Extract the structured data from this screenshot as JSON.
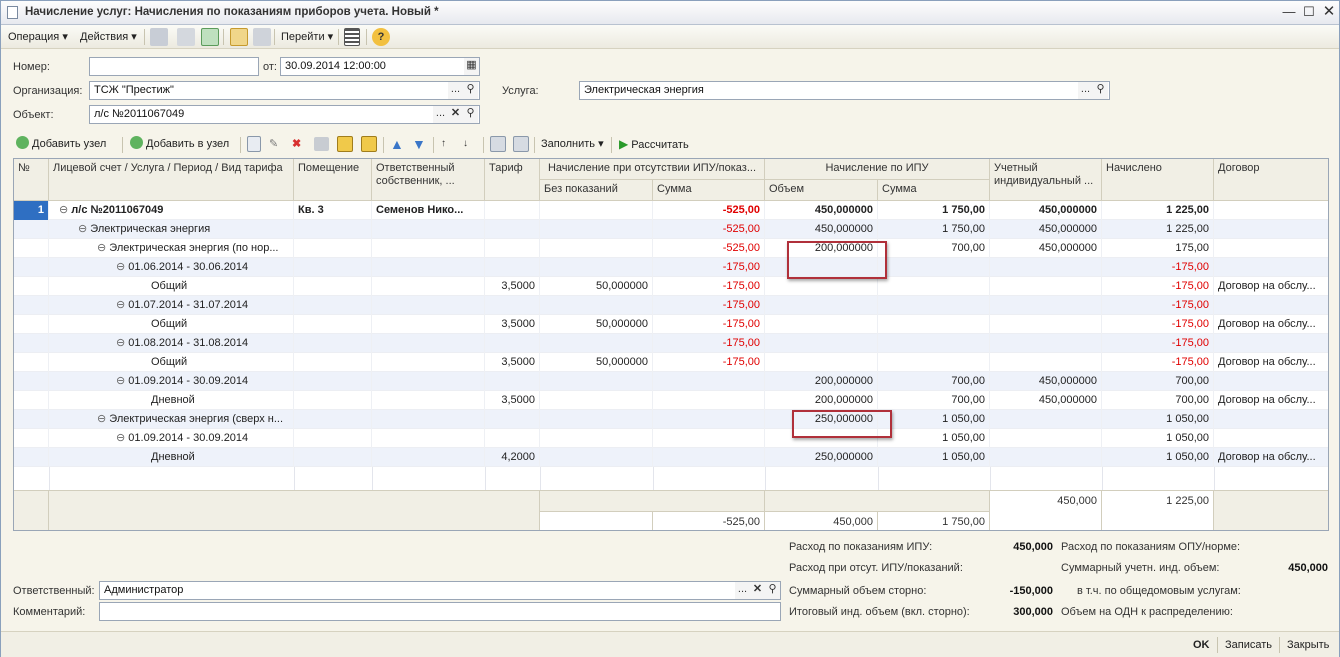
{
  "window": {
    "title": "Начисление услуг: Начисления по показаниям приборов учета. Новый *"
  },
  "menu": {
    "operation": "Операция",
    "actions": "Действия",
    "goto": "Перейти"
  },
  "form": {
    "number_label": "Номер:",
    "number_value": "",
    "from_label": "от:",
    "date_value": "30.09.2014 12:00:00",
    "org_label": "Организация:",
    "org_value": "ТСЖ \"Престиж\"",
    "service_label": "Услуга:",
    "service_value": "Электрическая энергия",
    "object_label": "Объект:",
    "object_value": "л/с №2011067049"
  },
  "toolbar2": {
    "add_node": "Добавить узел",
    "add_to_node": "Добавить в узел",
    "fill": "Заполнить",
    "calculate": "Рассчитать"
  },
  "table": {
    "headers": {
      "num": "№",
      "account": "Лицевой счет / Услуга / Период / Вид тарифа",
      "room": "Помещение",
      "owner": "Ответственный собственник, ...",
      "tariff": "Тариф",
      "no_ipu_group": "Начисление при отсутствии ИПУ/показ...",
      "no_readings": "Без показаний",
      "sum1": "Сумма",
      "ipu_group": "Начисление по ИПУ",
      "volume": "Объем",
      "sum2": "Сумма",
      "metered": "Учетный индивидуальный ...",
      "charged": "Начислено",
      "contract": "Договор"
    },
    "rows": [
      {
        "n": "1",
        "name": "л/с №2011067049",
        "room": "Кв. 3",
        "owner": "Семенов Нико...",
        "tariff": "",
        "noread": "",
        "sum1": "-525,00",
        "vol": "450,000000",
        "sum2": "1 750,00",
        "meter": "450,000000",
        "charged": "1 225,00",
        "contract": ""
      },
      {
        "n": "",
        "name": "Электрическая энергия",
        "room": "",
        "owner": "",
        "tariff": "",
        "noread": "",
        "sum1": "-525,00",
        "vol": "450,000000",
        "sum2": "1 750,00",
        "meter": "450,000000",
        "charged": "1 225,00",
        "contract": ""
      },
      {
        "n": "",
        "name": "Электрическая энергия (по нор...",
        "room": "",
        "owner": "",
        "tariff": "",
        "noread": "",
        "sum1": "-525,00",
        "vol": "200,000000",
        "sum2": "700,00",
        "meter": "450,000000",
        "charged": "175,00",
        "contract": ""
      },
      {
        "n": "",
        "name": "01.06.2014 - 30.06.2014",
        "room": "",
        "owner": "",
        "tariff": "",
        "noread": "",
        "sum1": "-175,00",
        "vol": "",
        "sum2": "",
        "meter": "",
        "charged": "-175,00",
        "contract": ""
      },
      {
        "n": "",
        "name": "Общий",
        "room": "",
        "owner": "",
        "tariff": "3,5000",
        "noread": "50,000000",
        "sum1": "-175,00",
        "vol": "",
        "sum2": "",
        "meter": "",
        "charged": "-175,00",
        "contract": "Договор на обслу..."
      },
      {
        "n": "",
        "name": "01.07.2014 - 31.07.2014",
        "room": "",
        "owner": "",
        "tariff": "",
        "noread": "",
        "sum1": "-175,00",
        "vol": "",
        "sum2": "",
        "meter": "",
        "charged": "-175,00",
        "contract": ""
      },
      {
        "n": "",
        "name": "Общий",
        "room": "",
        "owner": "",
        "tariff": "3,5000",
        "noread": "50,000000",
        "sum1": "-175,00",
        "vol": "",
        "sum2": "",
        "meter": "",
        "charged": "-175,00",
        "contract": "Договор на обслу..."
      },
      {
        "n": "",
        "name": "01.08.2014 - 31.08.2014",
        "room": "",
        "owner": "",
        "tariff": "",
        "noread": "",
        "sum1": "-175,00",
        "vol": "",
        "sum2": "",
        "meter": "",
        "charged": "-175,00",
        "contract": ""
      },
      {
        "n": "",
        "name": "Общий",
        "room": "",
        "owner": "",
        "tariff": "3,5000",
        "noread": "50,000000",
        "sum1": "-175,00",
        "vol": "",
        "sum2": "",
        "meter": "",
        "charged": "-175,00",
        "contract": "Договор на обслу..."
      },
      {
        "n": "",
        "name": "01.09.2014 - 30.09.2014",
        "room": "",
        "owner": "",
        "tariff": "",
        "noread": "",
        "sum1": "",
        "vol": "200,000000",
        "sum2": "700,00",
        "meter": "450,000000",
        "charged": "700,00",
        "contract": ""
      },
      {
        "n": "",
        "name": "Дневной",
        "room": "",
        "owner": "",
        "tariff": "3,5000",
        "noread": "",
        "sum1": "",
        "vol": "200,000000",
        "sum2": "700,00",
        "meter": "450,000000",
        "charged": "700,00",
        "contract": "Договор на обслу..."
      },
      {
        "n": "",
        "name": "Электрическая энергия (сверх н...",
        "room": "",
        "owner": "",
        "tariff": "",
        "noread": "",
        "sum1": "",
        "vol": "250,000000",
        "sum2": "1 050,00",
        "meter": "",
        "charged": "1 050,00",
        "contract": ""
      },
      {
        "n": "",
        "name": "01.09.2014 - 30.09.2014",
        "room": "",
        "owner": "",
        "tariff": "",
        "noread": "",
        "sum1": "",
        "vol": "",
        "sum2": "1 050,00",
        "meter": "",
        "charged": "1 050,00",
        "contract": ""
      },
      {
        "n": "",
        "name": "Дневной",
        "room": "",
        "owner": "",
        "tariff": "4,2000",
        "noread": "",
        "sum1": "",
        "vol": "250,000000",
        "sum2": "1 050,00",
        "meter": "",
        "charged": "1 050,00",
        "contract": "Договор на обслу..."
      }
    ],
    "footer": {
      "meter_total": "450,000",
      "charged_total": "1 225,00",
      "sum1_total": "-525,00",
      "vol_total": "450,000",
      "sum2_total": "1 750,00"
    }
  },
  "summary": {
    "ipu_label": "Расход по показаниям ИПУ:",
    "ipu_value": "450,000",
    "opu_label": "Расход по показаниям ОПУ/норме:",
    "opu_value": "",
    "no_ipu_label": "Расход при отсут. ИПУ/показаний:",
    "no_ipu_value": "",
    "total_ind_label": "Суммарный учетн. инд. объем:",
    "total_ind_value": "450,000",
    "storno_label": "Суммарный объем сторно:",
    "storno_value": "-150,000",
    "common_label": "в т.ч. по общедомовым услугам:",
    "common_value": "",
    "final_label": "Итоговый инд. объем (вкл. сторно):",
    "final_value": "300,000",
    "odn_label": "Объем на ОДН к распределению:",
    "odn_value": ""
  },
  "responsible": {
    "label": "Ответственный:",
    "value": "Администратор"
  },
  "comment": {
    "label": "Комментарий:",
    "value": ""
  },
  "buttons": {
    "ok": "OK",
    "save": "Записать",
    "close": "Закрыть"
  }
}
